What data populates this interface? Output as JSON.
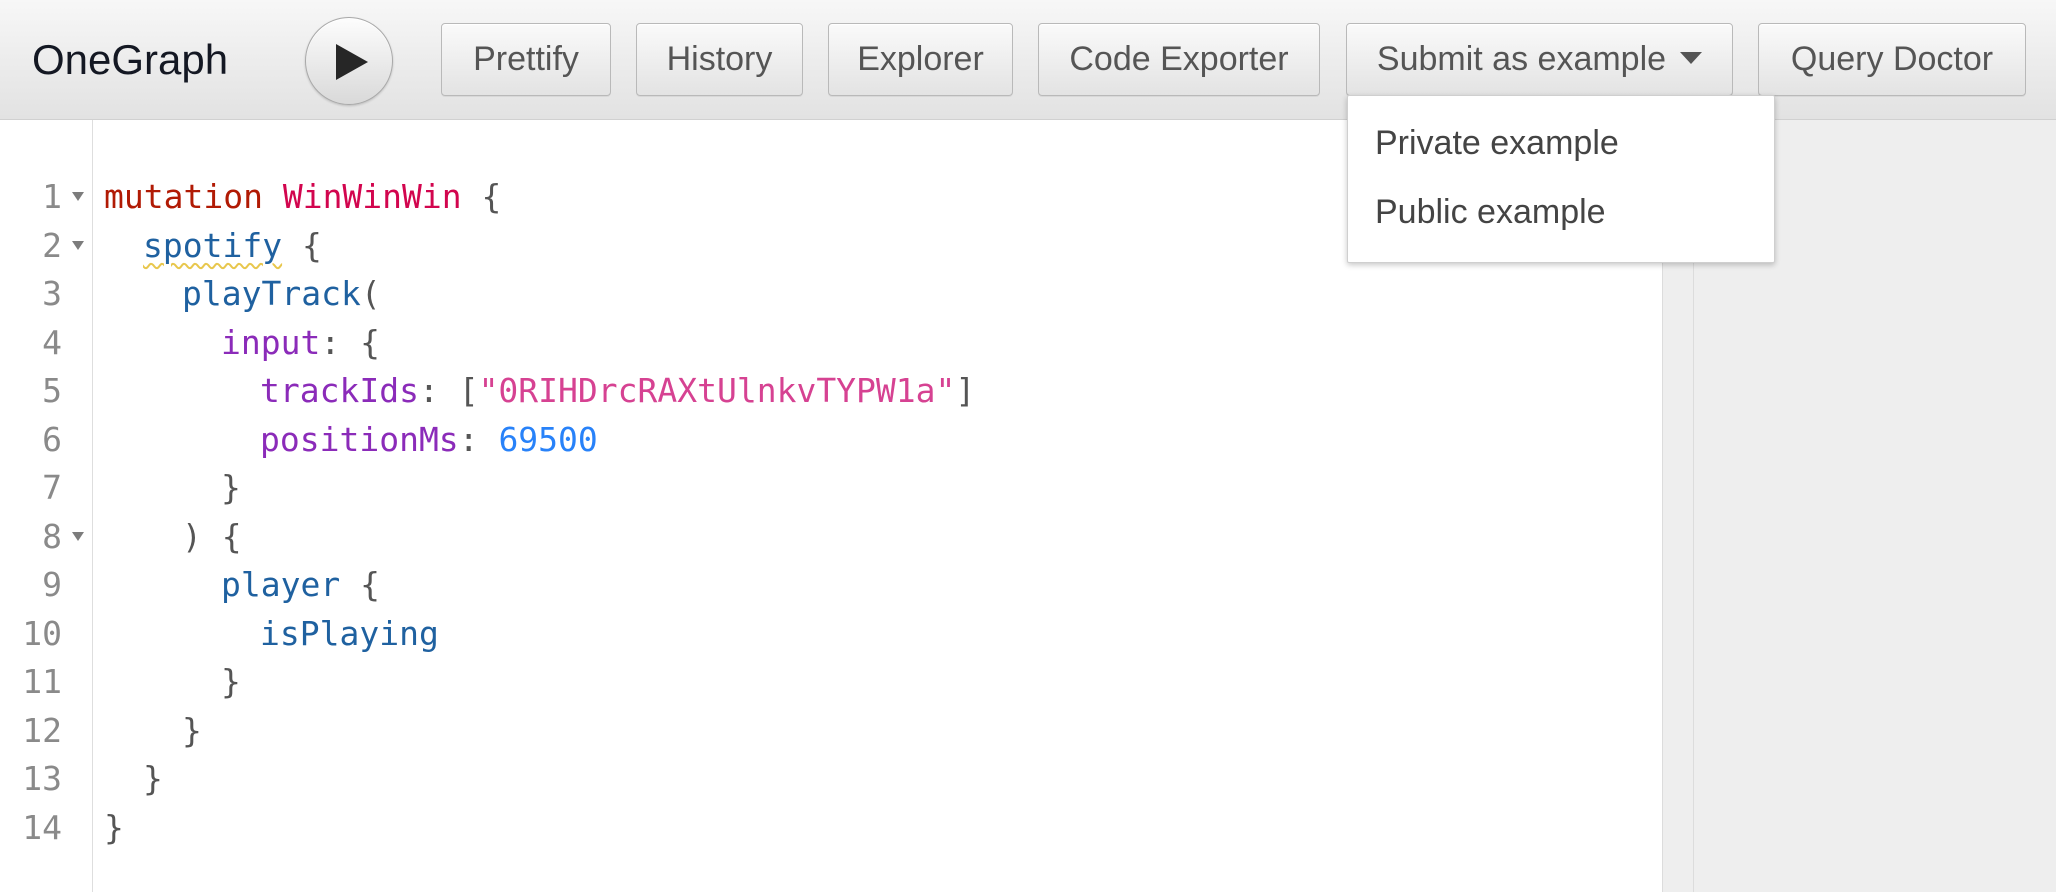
{
  "toolbar": {
    "app_title": "OneGraph",
    "run_icon": "play-icon",
    "buttons": {
      "prettify": "Prettify",
      "history": "History",
      "explorer": "Explorer",
      "code_exporter": "Code Exporter",
      "submit_as_example": "Submit as example",
      "query_doctor": "Query Doctor"
    }
  },
  "submit_dropdown": {
    "expanded": true,
    "items": [
      "Private example",
      "Public example"
    ]
  },
  "editor": {
    "lines": [
      {
        "n": "1",
        "fold": true,
        "indent": 0,
        "tokens": [
          {
            "t": "mutation",
            "k": "keyword"
          },
          {
            "t": " "
          },
          {
            "t": "WinWinWin",
            "k": "def"
          },
          {
            "t": " {",
            "k": "punct"
          }
        ]
      },
      {
        "n": "2",
        "fold": true,
        "indent": 1,
        "tokens": [
          {
            "t": "spotify",
            "k": "field",
            "squiggle": true
          },
          {
            "t": " {",
            "k": "punct"
          }
        ]
      },
      {
        "n": "3",
        "fold": false,
        "indent": 2,
        "tokens": [
          {
            "t": "playTrack",
            "k": "field"
          },
          {
            "t": "(",
            "k": "punct"
          }
        ]
      },
      {
        "n": "4",
        "fold": false,
        "indent": 3,
        "tokens": [
          {
            "t": "input",
            "k": "attr"
          },
          {
            "t": ": {",
            "k": "punct"
          }
        ]
      },
      {
        "n": "5",
        "fold": false,
        "indent": 4,
        "tokens": [
          {
            "t": "trackIds",
            "k": "attr"
          },
          {
            "t": ": [",
            "k": "punct"
          },
          {
            "t": "\"0RIHDrcRAXtUlnkvTYPW1a\"",
            "k": "string"
          },
          {
            "t": "]",
            "k": "punct"
          }
        ]
      },
      {
        "n": "6",
        "fold": false,
        "indent": 4,
        "tokens": [
          {
            "t": "positionMs",
            "k": "attr"
          },
          {
            "t": ": ",
            "k": "punct"
          },
          {
            "t": "69500",
            "k": "number"
          }
        ]
      },
      {
        "n": "7",
        "fold": false,
        "indent": 3,
        "tokens": [
          {
            "t": "}",
            "k": "punct"
          }
        ]
      },
      {
        "n": "8",
        "fold": true,
        "indent": 2,
        "tokens": [
          {
            "t": ") {",
            "k": "punct"
          }
        ]
      },
      {
        "n": "9",
        "fold": false,
        "indent": 3,
        "tokens": [
          {
            "t": "player",
            "k": "field"
          },
          {
            "t": " {",
            "k": "punct"
          }
        ]
      },
      {
        "n": "10",
        "fold": false,
        "indent": 4,
        "tokens": [
          {
            "t": "isPlaying",
            "k": "field"
          }
        ]
      },
      {
        "n": "11",
        "fold": false,
        "indent": 3,
        "tokens": [
          {
            "t": "}",
            "k": "punct"
          }
        ]
      },
      {
        "n": "12",
        "fold": false,
        "indent": 2,
        "tokens": [
          {
            "t": "}",
            "k": "punct"
          }
        ]
      },
      {
        "n": "13",
        "fold": false,
        "indent": 1,
        "tokens": [
          {
            "t": "}",
            "k": "punct"
          }
        ]
      },
      {
        "n": "14",
        "fold": false,
        "indent": 0,
        "tokens": [
          {
            "t": "}",
            "k": "punct"
          }
        ]
      }
    ]
  },
  "colors": {
    "keyword": "#b11a04",
    "definition": "#d2054e",
    "field": "#1f61a0",
    "attribute": "#8b2bb9",
    "string": "#d64292",
    "number": "#2882f9",
    "punctuation": "#555555",
    "line_number": "#8a8a8a",
    "toolbar_bg": "#e6e6e6",
    "result_pane_bg": "#eeeeee"
  }
}
